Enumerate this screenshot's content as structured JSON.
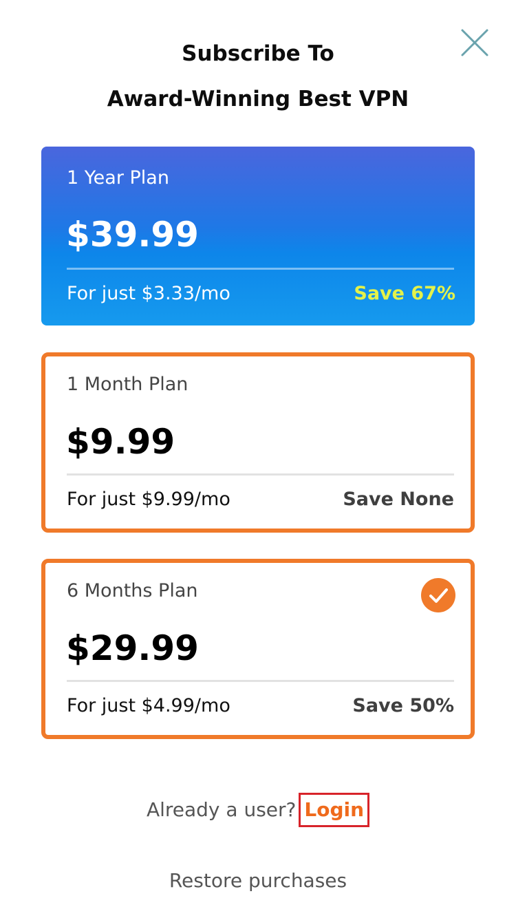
{
  "header": {
    "title_line1": "Subscribe To",
    "title_line2": "Award-Winning Best VPN",
    "close_icon": "close-icon"
  },
  "plans": [
    {
      "name": "1 Year Plan",
      "price": "$39.99",
      "per_month": "For just $3.33/mo",
      "savings": "Save 67%",
      "featured": true,
      "selected": false
    },
    {
      "name": "1 Month Plan",
      "price": "$9.99",
      "per_month": "For just $9.99/mo",
      "savings": "Save None",
      "featured": false,
      "selected": false
    },
    {
      "name": "6 Months Plan",
      "price": "$29.99",
      "per_month": "For just $4.99/mo",
      "savings": "Save 50%",
      "featured": false,
      "selected": true,
      "selected_icon": "checkmark-icon"
    }
  ],
  "footer": {
    "login_prompt": "Already a user?",
    "login_label": "Login",
    "restore_label": "Restore purchases"
  },
  "colors": {
    "accent_orange": "#f07a2a",
    "featured_blue": "#1f78e6",
    "featured_savings": "#e4f24a",
    "close_icon": "#6aa3ad",
    "login_highlight_border": "#d8232a"
  }
}
